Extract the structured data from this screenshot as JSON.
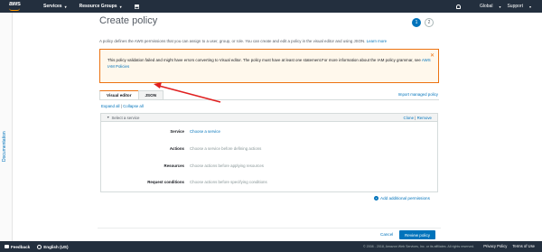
{
  "topnav": {
    "logo": "aws",
    "services": "Services",
    "resource_groups": "Resource Groups",
    "bell_icon": "bell-icon",
    "account": "Global",
    "support": "Support"
  },
  "docrail": {
    "label": "Documentation"
  },
  "page": {
    "title": "Create policy",
    "steps": [
      "1",
      "2"
    ],
    "description": "A policy defines the AWS permissions that you can assign to a user, group, or role. You can create and edit a policy in the visual editor and using JSON.",
    "learn_more": "Learn more"
  },
  "warning": {
    "text": "This policy validation failed and might have errors converting to Visual editor.  The policy must have at least one statement.For more information about the IAM policy grammar, see",
    "link": "AWS IAM Policies",
    "close_icon": "close-icon"
  },
  "tabs": {
    "visual": "Visual editor",
    "json": "JSON",
    "import": "Import managed policy"
  },
  "expand": {
    "expand_all": "Expand all",
    "separator": "|",
    "collapse_all": "Collapse all"
  },
  "panel": {
    "header": "Select a service",
    "clone": "Clone",
    "remove": "Remove",
    "rows": [
      {
        "label": "Service",
        "value": "Choose a service"
      },
      {
        "label": "Actions",
        "value": "Choose a service before defining actions"
      },
      {
        "label": "Resources",
        "value": "Choose actions before applying resources"
      },
      {
        "label": "Request conditions",
        "value": "Choose actions before specifying conditions"
      }
    ]
  },
  "add_permissions": "Add additional permissions",
  "actions": {
    "cancel": "Cancel",
    "review": "Review policy"
  },
  "footer": {
    "feedback": "Feedback",
    "language": "English (US)",
    "copyright": "© 2008 - 2018, Amazon Web Services, Inc. or its affiliates. All rights reserved.",
    "privacy": "Privacy Policy",
    "terms": "Terms of Use"
  },
  "colors": {
    "nav_bg": "#232f3e",
    "accent_orange": "#ec7211",
    "link_blue": "#0073bb",
    "warning_bg": "#fff8ec",
    "annotation_red": "#e02020"
  }
}
